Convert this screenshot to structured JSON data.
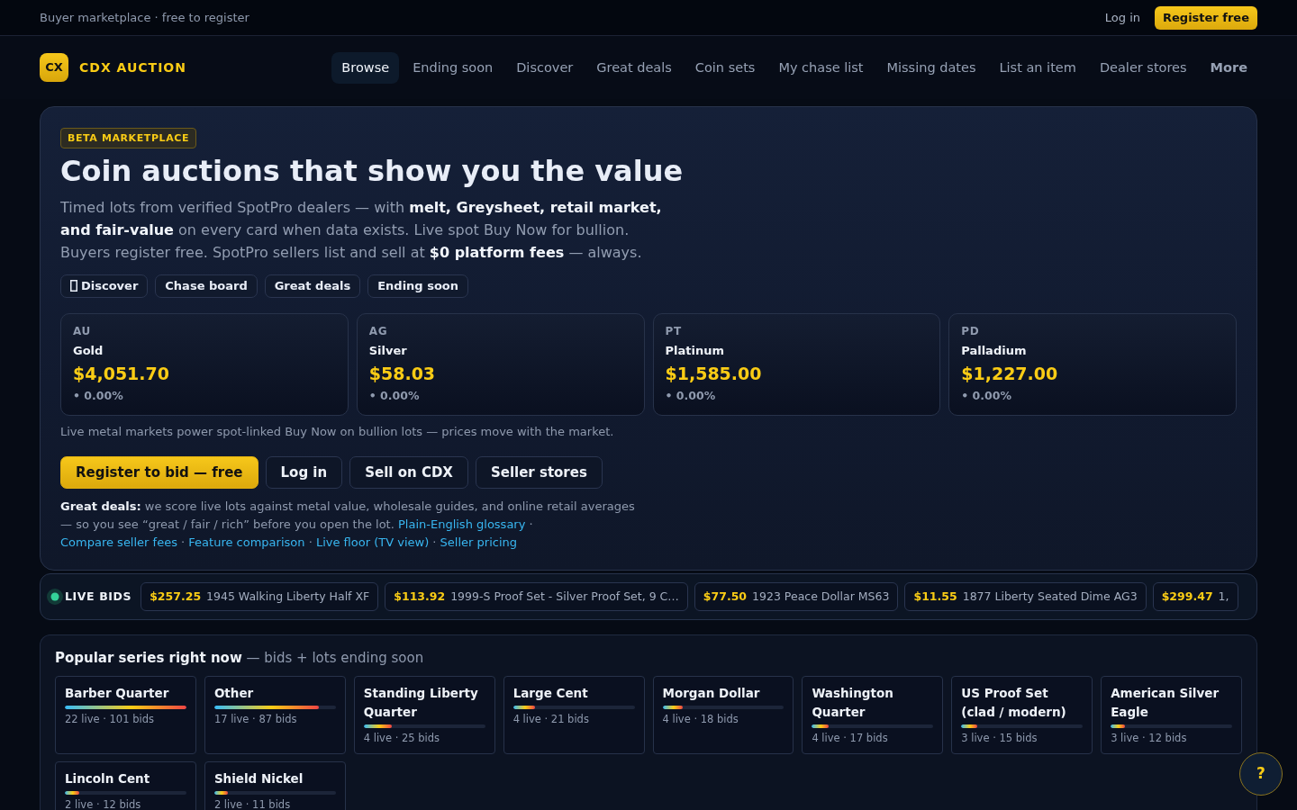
{
  "top_bar": {
    "tagline": "Buyer marketplace · free to register",
    "login": "Log in",
    "register": "Register free"
  },
  "brand": {
    "mark": "CX",
    "name": "CDX AUCTION"
  },
  "nav": {
    "items": [
      {
        "label": "Browse",
        "selected": true
      },
      {
        "label": "Ending soon",
        "selected": false
      },
      {
        "label": "Discover",
        "selected": false
      },
      {
        "label": "Great deals",
        "selected": false
      },
      {
        "label": "Coin sets",
        "selected": false
      },
      {
        "label": "My chase list",
        "selected": false
      },
      {
        "label": "Missing dates",
        "selected": false
      },
      {
        "label": "List an item",
        "selected": false
      },
      {
        "label": "Dealer stores",
        "selected": false
      }
    ],
    "more": "More"
  },
  "hero": {
    "badge": "BETA MARKETPLACE",
    "title": "Coin auctions that show you the value",
    "intro": "Timed lots from verified SpotPro dealers — with **melt, Greysheet, retail market, and fair-value** on every card when data exists. Live spot Buy Now for bullion. Buyers register free. SpotPro sellers list and sell at **$0 platform fees** — always.",
    "chips": [
      {
        "label": "Discover",
        "kind": "icon"
      },
      {
        "label": "Chase board",
        "kind": "plain"
      },
      {
        "label": "Great deals",
        "kind": "plain"
      },
      {
        "label": "Ending soon",
        "kind": "plain"
      }
    ],
    "metals": [
      {
        "symbol": "AU",
        "name": "Gold",
        "price": "$4,051.70",
        "change": "• 0.00%"
      },
      {
        "symbol": "AG",
        "name": "Silver",
        "price": "$58.03",
        "change": "• 0.00%"
      },
      {
        "symbol": "PT",
        "name": "Platinum",
        "price": "$1,585.00",
        "change": "• 0.00%"
      },
      {
        "symbol": "PD",
        "name": "Palladium",
        "price": "$1,227.00",
        "change": "• 0.00%"
      }
    ],
    "metals_note": "Live metal markets power spot-linked Buy Now on bullion lots — prices move with the market.",
    "actions": [
      {
        "label": "Register to bid — free",
        "kind": "primary"
      },
      {
        "label": "Log in",
        "kind": "outline"
      },
      {
        "label": "Sell on CDX",
        "kind": "outline"
      },
      {
        "label": "Seller stores",
        "kind": "outline"
      }
    ],
    "deals_note": {
      "text": "**Great deals:** we score live lots against metal value, wholesale guides, and online retail averages — so you see “great / fair / rich” before you open the lot.",
      "separator": "·",
      "links": [
        "Plain-English glossary",
        "Compare seller fees",
        "Feature comparison",
        "Live floor (TV view)",
        "Seller pricing"
      ]
    }
  },
  "live_bids": {
    "label": "LIVE BIDS",
    "items": [
      {
        "price": "$257.25",
        "title": "1945 Walking Liberty Half XF"
      },
      {
        "price": "$113.92",
        "title": "1999-S Proof Set - Silver Proof Set, 9 C…"
      },
      {
        "price": "$77.50",
        "title": "1923 Peace Dollar MS63"
      },
      {
        "price": "$11.55",
        "title": "1877 Liberty Seated Dime AG3"
      },
      {
        "price": "$299.47",
        "title": "1,"
      }
    ]
  },
  "popular_series": {
    "heading": "**Popular series right now** — bids + lots ending soon",
    "items": [
      {
        "name": "Barber Quarter",
        "level": 1.0,
        "stats": "22 live · 101 bids"
      },
      {
        "name": "Other",
        "level": 0.86,
        "stats": "17 live · 87 bids"
      },
      {
        "name": "Standing Liberty Quarter",
        "level": 0.23,
        "stats": "4 live · 25 bids"
      },
      {
        "name": "Large Cent",
        "level": 0.18,
        "stats": "4 live · 21 bids"
      },
      {
        "name": "Morgan Dollar",
        "level": 0.17,
        "stats": "4 live · 18 bids"
      },
      {
        "name": "Washington Quarter",
        "level": 0.14,
        "stats": "4 live · 17 bids"
      },
      {
        "name": "US Proof Set (clad / modern)",
        "level": 0.13,
        "stats": "3 live · 15 bids"
      },
      {
        "name": "American Silver Eagle",
        "level": 0.12,
        "stats": "3 live · 12 bids"
      },
      {
        "name": "Lincoln Cent",
        "level": 0.12,
        "stats": "2 live · 12 bids"
      },
      {
        "name": "Shield Nickel",
        "level": 0.11,
        "stats": "2 live · 11 bids"
      }
    ]
  },
  "help_button": "?"
}
